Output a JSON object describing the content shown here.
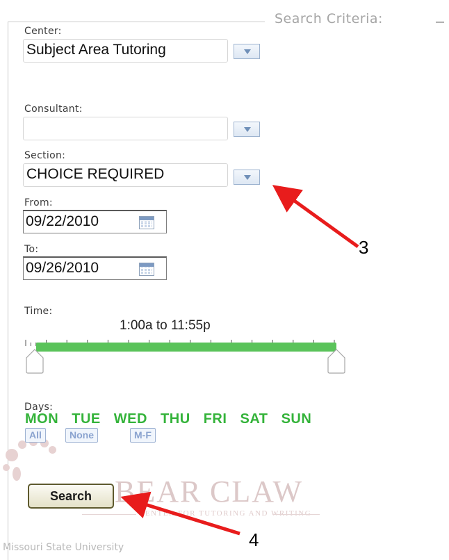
{
  "fieldset": {
    "legend": "Search Criteria:"
  },
  "center": {
    "label": "Center:",
    "value": "Subject Area Tutoring"
  },
  "consultant": {
    "label": "Consultant:",
    "value": ""
  },
  "section": {
    "label": "Section:",
    "value": "CHOICE REQUIRED"
  },
  "from": {
    "label": "From:",
    "value": "09/22/2010"
  },
  "to": {
    "label": "To:",
    "value": "09/26/2010"
  },
  "time": {
    "label": "Time:",
    "range": "1:00a to 11:55p"
  },
  "days": {
    "label": "Days:",
    "items": [
      "MON",
      "TUE",
      "WED",
      "THU",
      "FRI",
      "SAT",
      "SUN"
    ],
    "color": "#34b33a",
    "quick": [
      "All",
      "None",
      "M-F"
    ]
  },
  "search_button": {
    "label": "Search"
  },
  "logo": {
    "word1": "BEAR",
    "word2": "CLAW",
    "tagline": "CENTER FOR TUTORING AND WRITING"
  },
  "footer": {
    "text": "Missouri State University"
  },
  "annotations": {
    "callout_3": "3",
    "callout_4": "4",
    "arrow_color": "#e81c1c"
  }
}
